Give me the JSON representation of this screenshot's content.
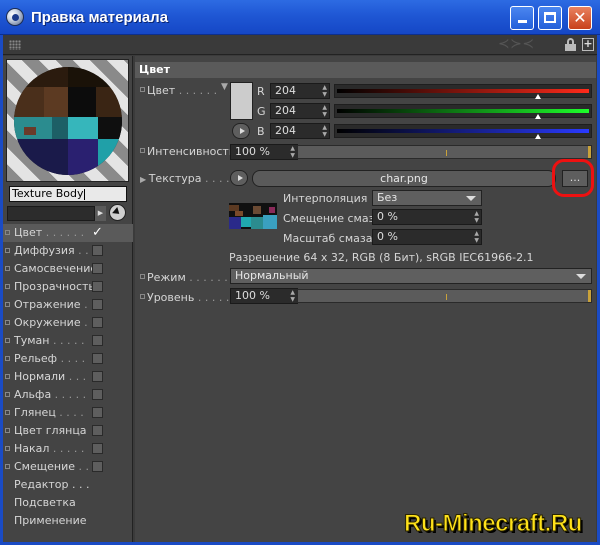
{
  "window": {
    "title": "Правка материала",
    "close_glyph": "✕",
    "newwin_glyph": "+"
  },
  "preview": {
    "material_name": "Texture Body"
  },
  "channels": [
    {
      "label": "Цвет",
      "dots": " . . . . . .",
      "checked": true,
      "selected": true
    },
    {
      "label": "Диффузия",
      "dots": " . . .",
      "checked": false
    },
    {
      "label": "Самосвечение",
      "dots": "",
      "checked": false
    },
    {
      "label": "Прозрачность",
      "dots": "",
      "checked": false
    },
    {
      "label": "Отражение",
      "dots": " . . .",
      "checked": false
    },
    {
      "label": "Окружение",
      "dots": " . .",
      "checked": false
    },
    {
      "label": "Туман",
      "dots": " . . . . .",
      "checked": false
    },
    {
      "label": "Рельеф",
      "dots": " . . . .",
      "checked": false
    },
    {
      "label": "Нормали",
      "dots": " . . .",
      "checked": false
    },
    {
      "label": "Альфа",
      "dots": " . . . . .",
      "checked": false
    },
    {
      "label": "Глянец",
      "dots": " . . . .",
      "checked": false
    },
    {
      "label": "Цвет глянца",
      "dots": "",
      "checked": false
    },
    {
      "label": "Накал",
      "dots": " . . . . .",
      "checked": false
    },
    {
      "label": "Смещение",
      "dots": " . .",
      "checked": false
    }
  ],
  "extras": [
    "Редактор . . .",
    "Подсветка",
    "Применение"
  ],
  "check_glyph": "✓",
  "color_section": {
    "header": "Цвет",
    "color_label": "Цвет",
    "color_dots": " . . . . . .",
    "swatch_color": "#cccccc",
    "r_label": "R",
    "g_label": "G",
    "b_label": "B",
    "r_value": "204",
    "g_value": "204",
    "b_value": "204",
    "r": 204,
    "g": 204,
    "b": 204,
    "intensity_label": "Интенсивность",
    "intensity_value": "100 %",
    "intensity": 100,
    "texture_label": "Текстура",
    "texture_dots": " . . . . .",
    "texture_file": "char.png",
    "browse_label": "...",
    "interpolation_label": "Интерполяция",
    "interpolation_value": "Без",
    "offset_label": "Смещение смаза",
    "offset_value": "0 %",
    "scale_label": "Масштаб смаза",
    "scale_value": "0 %",
    "resolution_text": "Разрешение 64 x 32, RGB (8 Бит), sRGB IEC61966-2.1",
    "mode_label": "Режим",
    "mode_dots": " . . . . . . .",
    "mode_value": "Нормальный",
    "level_label": "Уровень",
    "level_dots": " . . . . . .",
    "level_value": "100 %",
    "level": 100
  },
  "watermark": "Ru-Minecraft.Ru",
  "colors": {
    "title_bar": "#1f57d4",
    "panel_bg": "#444444",
    "highlight": "#ee1111",
    "slider_accent": "#c9a23a",
    "watermark": "#ffe21a"
  }
}
